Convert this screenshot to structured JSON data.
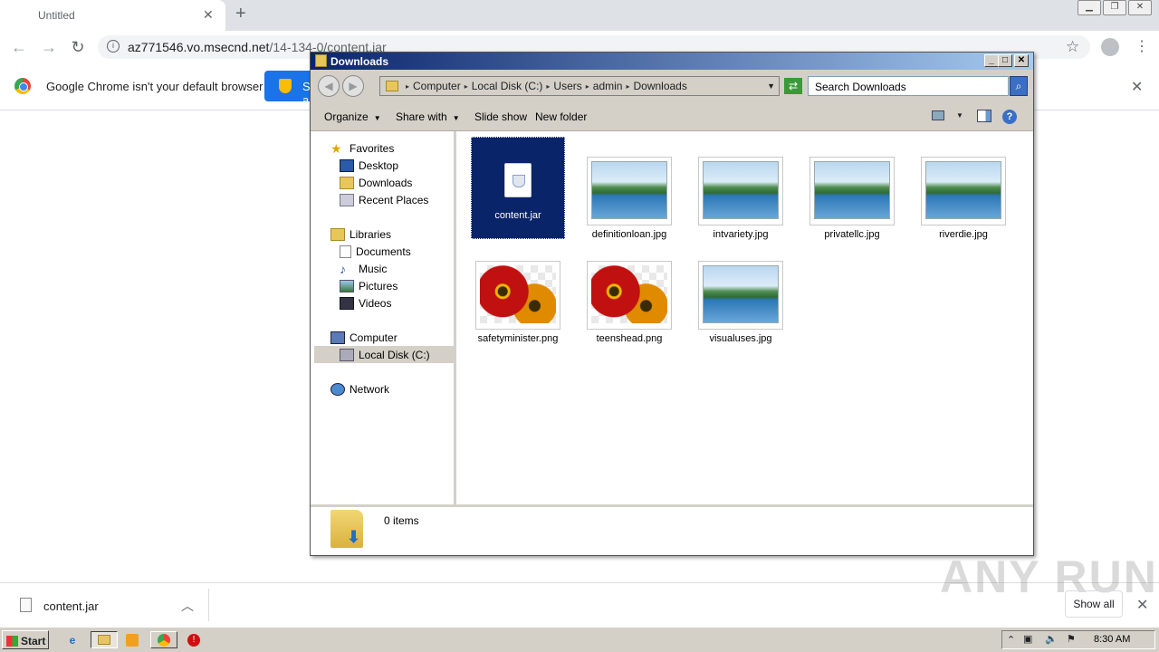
{
  "browser": {
    "tab_title": "Untitled",
    "url_host": "az771546.vo.msecnd.net",
    "url_path": "/14-134-0/content.jar",
    "infobar_text": "Google Chrome isn't your default browser",
    "set_default_label": "Set as default"
  },
  "download_shelf": {
    "file_name": "content.jar",
    "show_all": "Show all"
  },
  "explorer": {
    "title": "Downloads",
    "breadcrumbs": [
      "Computer",
      "Local Disk (C:)",
      "Users",
      "admin",
      "Downloads"
    ],
    "search_placeholder": "Search Downloads",
    "commands": {
      "organize": "Organize",
      "share_with": "Share with",
      "slide_show": "Slide show",
      "new_folder": "New folder"
    },
    "nav": {
      "favorites": "Favorites",
      "desktop": "Desktop",
      "downloads": "Downloads",
      "recent": "Recent Places",
      "libraries": "Libraries",
      "documents": "Documents",
      "music": "Music",
      "pictures": "Pictures",
      "videos": "Videos",
      "computer": "Computer",
      "local_disk": "Local Disk (C:)",
      "network": "Network"
    },
    "files": [
      {
        "name": "content.jar",
        "type": "jar"
      },
      {
        "name": "definitionloan.jpg",
        "type": "landscape"
      },
      {
        "name": "intvariety.jpg",
        "type": "landscape"
      },
      {
        "name": "privatellc.jpg",
        "type": "landscape"
      },
      {
        "name": "riverdie.jpg",
        "type": "landscape"
      },
      {
        "name": "safetyminister.png",
        "type": "flower"
      },
      {
        "name": "teenshead.png",
        "type": "flower"
      },
      {
        "name": "visualuses.jpg",
        "type": "landscape"
      }
    ],
    "details_text": "0 items"
  },
  "taskbar": {
    "start_label": "Start",
    "clock": "8:30 AM"
  },
  "watermark": "ANY RUN"
}
